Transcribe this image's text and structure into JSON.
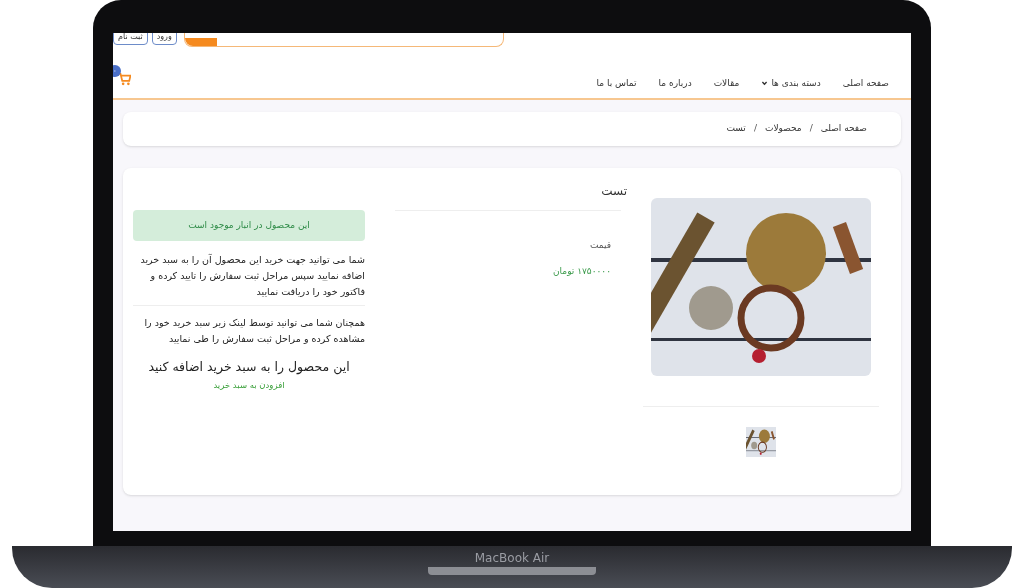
{
  "header": {
    "buttons": [
      "ورود",
      "ثبت نام"
    ]
  },
  "nav": {
    "items": [
      {
        "label": "صفحه اصلی",
        "dropdown": false
      },
      {
        "label": "دسته بندی ها",
        "dropdown": true
      },
      {
        "label": "مقالات",
        "dropdown": false
      },
      {
        "label": "درباره ما",
        "dropdown": false
      },
      {
        "label": "تماس با ما",
        "dropdown": false
      }
    ],
    "cart_count": "۰"
  },
  "breadcrumb": {
    "items": [
      "صفحه اصلی",
      "محصولات",
      "تست"
    ],
    "separator": "/"
  },
  "product": {
    "title": "تست",
    "price_label": "قیمت",
    "price": "۱۷۵۰۰۰۰ تومان",
    "stock_notice": "این محصول در انبار موجود است",
    "paragraphs": [
      "شما می توانید جهت خرید این محصول آن را به سبد خرید اضافه نمایید سپس مراحل ثبت سفارش را تایید کرده و فاکتور خود را دریافت نمایید",
      "همچنان شما می توانید توسط لینک زیر سبد خرید خود را مشاهده کرده و مراحل ثبت سفارش را طی نمایید"
    ],
    "add_heading": "این محصول را به سبد خرید اضافه کنید",
    "add_link": "افزودن به سبد خرید"
  },
  "device": {
    "label": "MacBook Air"
  }
}
